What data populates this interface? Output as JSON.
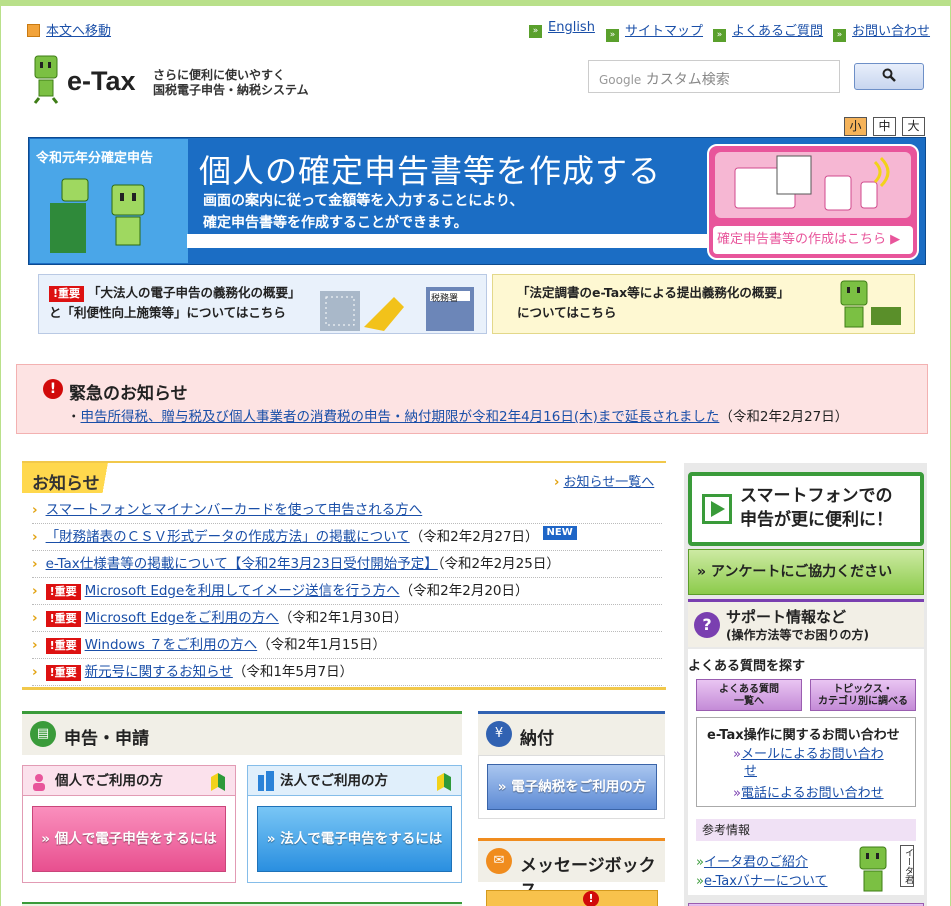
{
  "header": {
    "skip_link": "本文へ移動",
    "top_links": [
      "English",
      "サイトマップ",
      "よくあるご質問",
      "お問い合わせ"
    ],
    "logo_word": "e-Tax",
    "logo_sub1": "さらに便利に使いやすく",
    "logo_sub2": "国税電子申告・納税システム",
    "search_brand": "Google",
    "search_placeholder": "カスタム検索",
    "font_sizes": [
      "小",
      "中",
      "大"
    ]
  },
  "hero": {
    "badge": "令和元年分確定申告",
    "title": "個人の確定申告書等を作成する",
    "desc1": "画面の案内に従って金額等を入力することにより、",
    "desc2": "確定申告書等を作成することができます。",
    "cta": "確定申告書等の作成はこちら"
  },
  "banners": {
    "left_badge": "重要",
    "left_line1": "「大法人の電子申告の義務化の概要」",
    "left_line2": "と「利便性向上施策等」についてはこちら",
    "tax_office": "税務署",
    "right_line1": "「法定調書のe-Tax等による提出義務化の概要」",
    "right_line2": "についてはこちら"
  },
  "emergency": {
    "title": "緊急のお知らせ",
    "link": "申告所得税、贈与税及び個人事業者の消費税の申告・納付期限が令和2年4月16日(木)まで延長されました",
    "date": "（令和2年2月27日）"
  },
  "news": {
    "title": "お知らせ",
    "all_link": "お知らせ一覧へ",
    "items": [
      {
        "important": false,
        "text": "スマートフォンとマイナンバーカードを使って申告される方へ",
        "date": "",
        "new": false
      },
      {
        "important": false,
        "text": "「財務諸表のＣＳＶ形式データの作成方法」の掲載について",
        "date": "（令和2年2月27日）",
        "new": true
      },
      {
        "important": false,
        "text": "e-Tax仕様書等の掲載について【令和2年3月23日受付開始予定】",
        "date": "（令和2年2月25日）",
        "new": false
      },
      {
        "important": true,
        "text": "Microsoft Edgeを利用してイメージ送信を行う方へ",
        "date": "（令和2年2月20日）",
        "new": false
      },
      {
        "important": true,
        "text": "Microsoft Edgeをご利用の方へ",
        "date": "（令和2年1月30日）",
        "new": false
      },
      {
        "important": true,
        "text": "Windows ７をご利用の方へ",
        "date": "（令和2年1月15日）",
        "new": false
      },
      {
        "important": true,
        "text": "新元号に関するお知らせ",
        "date": "（令和1年5月7日）",
        "new": false
      }
    ],
    "important_label": "重要",
    "new_label": "NEW"
  },
  "sections": {
    "apply_title": "申告・申請",
    "personal_head": "個人でご利用の方",
    "personal_btn": "個人で電子申告をするには",
    "corp_head": "法人でご利用の方",
    "corp_btn": "法人で電子申告をするには",
    "pay_title": "納付",
    "pay_btn": "電子納税をご利用の方",
    "msg_title": "メッセージボックス"
  },
  "right": {
    "smartphone_line1": "スマートフォンでの",
    "smartphone_line2": "申告が更に便利に！",
    "survey": "アンケートにご協力ください",
    "support_title": "サポート情報など",
    "support_sub": "(操作方法等でお困りの方)",
    "faq_head": "よくある質問を探す",
    "faq_btn1a": "よくある質問",
    "faq_btn1b": "一覧へ",
    "faq_btn2a": "トピックス・",
    "faq_btn2b": "カテゴリ別に調べる",
    "contact_head": "e-Tax操作に関するお問い合わせ",
    "contact_mail1": "メールによるお問い合わ",
    "contact_mail2": "せ",
    "contact_phone": "電話によるお問い合わせ",
    "ref_head": "参考情報",
    "ref1": "イータ君のご紹介",
    "ref2": "e-Taxバナーについて",
    "eta_label": "イータ君"
  }
}
